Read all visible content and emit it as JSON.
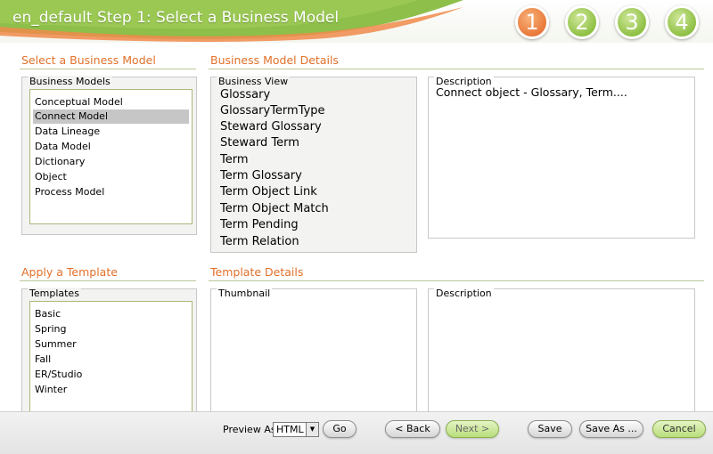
{
  "header": {
    "title": "en_default Step 1: Select a Business Model",
    "steps": [
      "1",
      "2",
      "3",
      "4"
    ]
  },
  "business_models": {
    "section_title": "Select a Business Model",
    "group_label": "Business Models",
    "items": [
      "Conceptual Model",
      "Connect Model",
      "Data Lineage",
      "Data Model",
      "Dictionary",
      "Object",
      "Process Model"
    ],
    "selected": "Connect Model"
  },
  "model_details": {
    "section_title": "Business Model Details",
    "business_view_label": "Business View",
    "business_view_items": [
      "Glossary",
      "GlossaryTermType",
      "Steward Glossary",
      "Steward Term",
      "Term",
      "Term Glossary",
      "Term Object Link",
      "Term Object Match",
      "Term Pending",
      "Term Relation"
    ],
    "description_label": "Description",
    "description_text": "Connect object - Glossary, Term...."
  },
  "templates": {
    "section_title": "Apply a Template",
    "group_label": "Templates",
    "items": [
      "Basic",
      "Spring",
      "Summer",
      "Fall",
      "ER/Studio",
      "Winter"
    ]
  },
  "template_details": {
    "section_title": "Template Details",
    "thumbnail_label": "Thumbnail",
    "description_label": "Description"
  },
  "footer": {
    "preview_label": "Preview As:",
    "preview_value": "HTML",
    "go": "Go",
    "back": "< Back",
    "next": "Next >",
    "save": "Save",
    "save_as": "Save As ...",
    "cancel": "Cancel"
  },
  "colors": {
    "section_title": "#e2702a",
    "active_step": "#e8793a",
    "inactive_step": "#8fc044",
    "selected_row": "#c6c6c6"
  }
}
